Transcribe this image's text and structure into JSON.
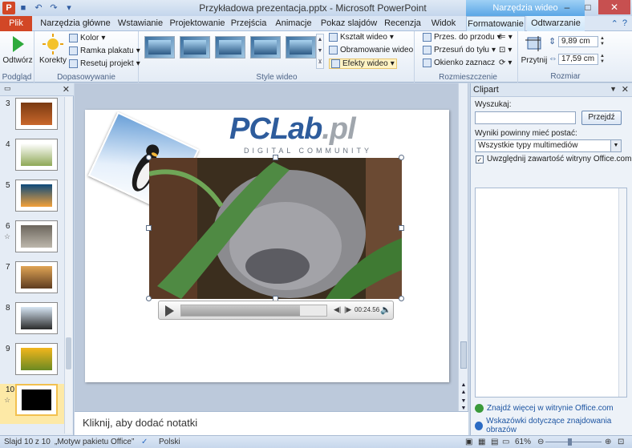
{
  "title": "Przykładowa prezentacja.pptx - Microsoft PowerPoint",
  "context_tools_label": "Narzędzia wideo",
  "tabs": [
    "Plik",
    "Narzędzia główne",
    "Wstawianie",
    "Projektowanie",
    "Przejścia",
    "Animacje",
    "Pokaz slajdów",
    "Recenzja",
    "Widok",
    "Formatowanie",
    "Odtwarzanie"
  ],
  "ribbon": {
    "preview": {
      "play_label": "Odtwórz",
      "group": "Podgląd"
    },
    "adjust": {
      "corrections_label": "Korekty",
      "color_label": "Kolor",
      "poster_label": "Ramka plakatu",
      "reset_label": "Resetuj projekt",
      "group": "Dopasowywanie"
    },
    "styles": {
      "shape_label": "Kształt wideo",
      "border_label": "Obramowanie wideo",
      "effects_label": "Efekty wideo",
      "group": "Style wideo"
    },
    "arrange": {
      "forward_label": "Przes. do przodu",
      "backward_label": "Przesuń do tyłu",
      "selection_label": "Okienko zaznacz",
      "group": "Rozmieszczenie"
    },
    "size": {
      "crop_label": "Przytnij",
      "height": "9,89 cm",
      "width": "17,59 cm",
      "group": "Rozmiar"
    }
  },
  "thumbnails": [
    {
      "num": "3",
      "star": false,
      "colors": [
        "#7a3a12",
        "#c9672b"
      ]
    },
    {
      "num": "4",
      "star": false,
      "colors": [
        "#ffffff",
        "#8fa857"
      ]
    },
    {
      "num": "5",
      "star": false,
      "colors": [
        "#0d4a7a",
        "#f2a13a"
      ]
    },
    {
      "num": "6",
      "star": true,
      "colors": [
        "#6c665d",
        "#bdb7ac"
      ]
    },
    {
      "num": "7",
      "star": false,
      "colors": [
        "#e0a455",
        "#5e3c20"
      ]
    },
    {
      "num": "8",
      "star": false,
      "colors": [
        "#d7e6f4",
        "#2b2b2b"
      ]
    },
    {
      "num": "9",
      "star": false,
      "colors": [
        "#f3b61c",
        "#6b8a22"
      ]
    },
    {
      "num": "10",
      "star": true,
      "colors": [
        "#000000",
        "#000000"
      ]
    }
  ],
  "slide": {
    "logo_main": "PCLab",
    "logo_tld": ".pl",
    "logo_sub": "DIGITAL COMMUNITY",
    "player_time": "00:24.56",
    "progress": 0.82
  },
  "notes_placeholder": "Kliknij, aby dodać notatki",
  "clipart": {
    "title": "Clipart",
    "search_label": "Wyszukaj:",
    "search_value": "",
    "go_label": "Przejdź",
    "results_label": "Wyniki powinny mieć postać:",
    "media_type": "Wszystkie typy multimediów",
    "include_label": "Uwzględnij zawartość witryny Office.com",
    "include_checked": true,
    "link_more": "Znajdź więcej w witrynie Office.com",
    "link_hints": "Wskazówki dotyczące znajdowania obrazów"
  },
  "status": {
    "slide_info": "Slajd 10 z 10",
    "theme": "„Motyw pakietu Office”",
    "language": "Polski",
    "zoom": "61%"
  },
  "colors": {
    "file_tab": "#d24726",
    "context_header": "#5aa7e6",
    "selection": "#f2c04f"
  }
}
